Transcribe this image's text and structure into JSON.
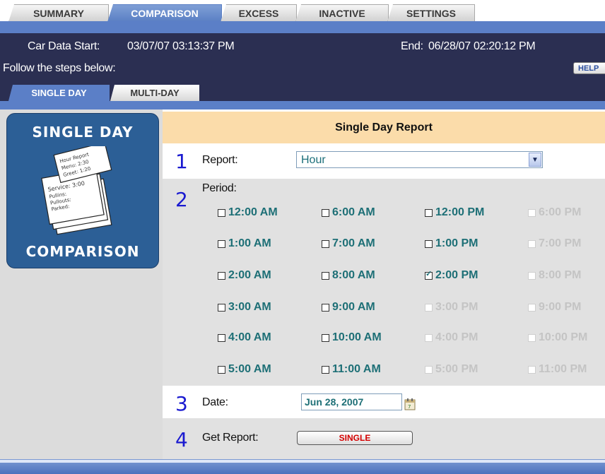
{
  "top_tabs": [
    {
      "label": "SUMMARY",
      "active": false
    },
    {
      "label": "COMPARISON",
      "active": true
    },
    {
      "label": "EXCESS",
      "active": false
    },
    {
      "label": "INACTIVE",
      "active": false
    },
    {
      "label": "SETTINGS",
      "active": false
    }
  ],
  "header": {
    "start_label": "Car Data Start:",
    "start_value": "03/07/07 03:13:37 PM",
    "end_label": "End:",
    "end_value": "06/28/07 02:20:12 PM",
    "instructions": "Follow the steps below:",
    "help_label": "HELP"
  },
  "sub_tabs": [
    {
      "label": "SINGLE DAY",
      "active": true
    },
    {
      "label": "MULTI-DAY",
      "active": false
    }
  ],
  "logo": {
    "top_text": "SINGLE DAY",
    "bottom_text": "COMPARISON",
    "card_lines": [
      "Hour Report",
      "Menu: 2:30",
      "Greet: 1:20",
      "Service: 3:00",
      "Pullins:",
      "Pullouts:",
      "Parked:"
    ]
  },
  "report": {
    "title": "Single Day Report",
    "steps": [
      {
        "num": "1",
        "label": "Report:"
      },
      {
        "num": "2",
        "label": "Period:"
      },
      {
        "num": "3",
        "label": "Date:"
      },
      {
        "num": "4",
        "label": "Get Report:"
      }
    ],
    "report_type": "Hour",
    "date_value": "Jun 28, 2007",
    "button_label": "SINGLE",
    "hours": [
      [
        "12:00 AM",
        "6:00 AM",
        "12:00 PM",
        "6:00 PM"
      ],
      [
        "1:00 AM",
        "7:00 AM",
        "1:00 PM",
        "7:00 PM"
      ],
      [
        "2:00 AM",
        "8:00 AM",
        "2:00 PM",
        "8:00 PM"
      ],
      [
        "3:00 AM",
        "9:00 AM",
        "3:00 PM",
        "9:00 PM"
      ],
      [
        "4:00 AM",
        "10:00 AM",
        "4:00 PM",
        "10:00 PM"
      ],
      [
        "5:00 AM",
        "11:00 AM",
        "5:00 PM",
        "11:00 PM"
      ]
    ],
    "hours_enabled": [
      [
        true,
        true,
        true,
        false
      ],
      [
        true,
        true,
        true,
        false
      ],
      [
        true,
        true,
        true,
        false
      ],
      [
        true,
        true,
        false,
        false
      ],
      [
        true,
        true,
        false,
        false
      ],
      [
        true,
        true,
        false,
        false
      ]
    ],
    "hours_checked": [
      [
        false,
        false,
        false,
        false
      ],
      [
        false,
        false,
        false,
        false
      ],
      [
        false,
        false,
        true,
        false
      ],
      [
        false,
        false,
        false,
        false
      ],
      [
        false,
        false,
        false,
        false
      ],
      [
        false,
        false,
        false,
        false
      ]
    ]
  },
  "colors": {
    "header_bg": "#2b2f52",
    "accent_blue": "#5b7fc7",
    "title_bar": "#fbdcaa",
    "enabled_text": "#1d6f76",
    "disabled_text": "#c4c4c4",
    "step_number": "#1a1ad0",
    "button_text": "#d40000"
  }
}
